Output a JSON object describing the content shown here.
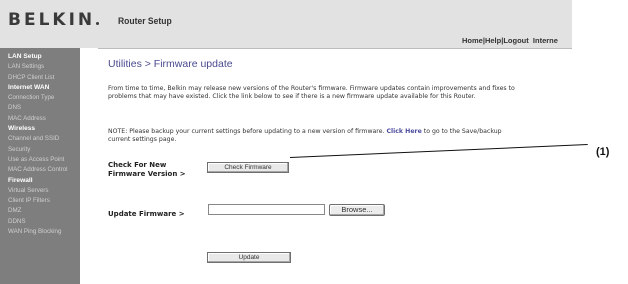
{
  "header": {
    "logo": "BELKIN",
    "title": "Router Setup",
    "links": [
      "Home",
      "Help",
      "Logout",
      "Interne"
    ]
  },
  "sidebar": {
    "items": [
      {
        "label": "LAN Setup",
        "section": true
      },
      {
        "label": "LAN Settings",
        "section": false
      },
      {
        "label": "DHCP Client List",
        "section": false
      },
      {
        "label": "Internet WAN",
        "section": true
      },
      {
        "label": "Connection Type",
        "section": false
      },
      {
        "label": "DNS",
        "section": false
      },
      {
        "label": "MAC Address",
        "section": false
      },
      {
        "label": "Wireless",
        "section": true
      },
      {
        "label": "Channel and SSID",
        "section": false
      },
      {
        "label": "Security",
        "section": false
      },
      {
        "label": "Use as Access Point",
        "section": false
      },
      {
        "label": "MAC Address Control",
        "section": false
      },
      {
        "label": "Firewall",
        "section": true
      },
      {
        "label": "Virtual Servers",
        "section": false
      },
      {
        "label": "Client IP Filters",
        "section": false
      },
      {
        "label": "DMZ",
        "section": false
      },
      {
        "label": "DDNS",
        "section": false
      },
      {
        "label": "WAN Ping Blocking",
        "section": false
      }
    ]
  },
  "main": {
    "title": "Utilities > Firmware update",
    "intro": "From time to time, Belkin may release new versions of the Router's firmware. Firmware updates contain improvements and fixes to problems that may have existed. Click the link below to see if there is a new firmware update available for this Router.",
    "note_prefix": "NOTE: Please backup your current settings before updating to a new version of firmware.",
    "note_link": "Click Here",
    "note_suffix": "to go to the Save/backup current settings page.",
    "check_label_line1": "Check For New",
    "check_label_line2": "Firmware Version >",
    "check_button": "Check Firmware",
    "update_label": "Update Firmware >",
    "file_value": "",
    "browse_button": "Browse...",
    "update_button": "Update"
  },
  "annotation": {
    "label": "(1)"
  }
}
